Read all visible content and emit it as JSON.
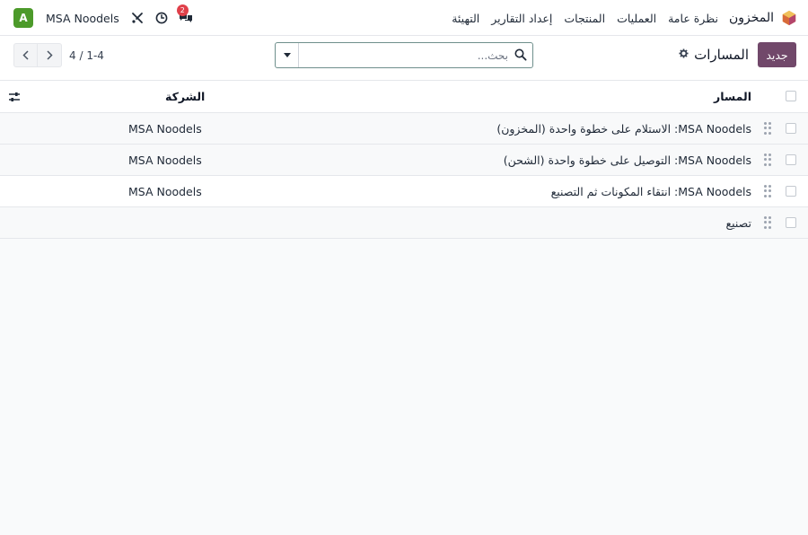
{
  "navbar": {
    "app_name": "المخزون",
    "menu": [
      {
        "label": "نظرة عامة"
      },
      {
        "label": "العمليات"
      },
      {
        "label": "المنتجات"
      },
      {
        "label": "إعداد التقارير"
      },
      {
        "label": "التهيئة"
      }
    ],
    "company": "MSA Noodels",
    "avatar_letter": "A",
    "chat_badge": "2"
  },
  "control_panel": {
    "new_button": "جديد",
    "title": "المسارات",
    "search_placeholder": "بحث...",
    "pager": "1-4 / 4"
  },
  "list": {
    "columns": {
      "name": "المسار",
      "company": "الشركة"
    },
    "rows": [
      {
        "name": "MSA Noodels: الاستلام على خطوة واحدة (المخزون)",
        "company": "MSA Noodels"
      },
      {
        "name": "MSA Noodels: التوصيل على خطوة واحدة (الشحن)",
        "company": "MSA Noodels"
      },
      {
        "name": "MSA Noodels: انتقاء المكونات ثم التصنيع",
        "company": "MSA Noodels"
      },
      {
        "name": "تصنيع",
        "company": ""
      }
    ]
  },
  "colors": {
    "brand": "#71486a",
    "avatar": "#4c9a2a",
    "badge": "#e0404a"
  }
}
